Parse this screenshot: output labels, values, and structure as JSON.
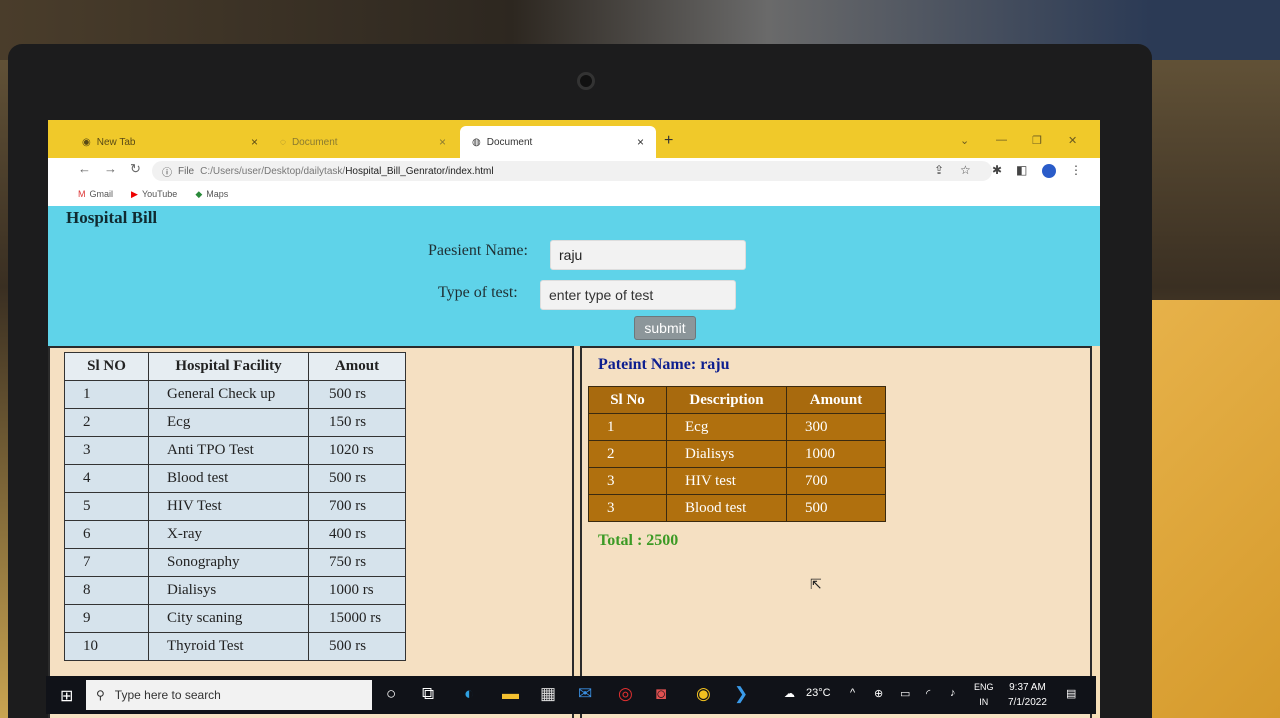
{
  "browser": {
    "tabs": [
      {
        "title": "New Tab"
      },
      {
        "title": "Document"
      },
      {
        "title": "Document"
      }
    ],
    "address": {
      "scheme": "File",
      "path_prefix": "C:/Users/user/Desktop/dailytask/",
      "path_main": "Hospital_Bill_Genrator/index.html"
    },
    "bookmarks": [
      {
        "label": "Gmail",
        "icon": "gmail-icon"
      },
      {
        "label": "YouTube",
        "icon": "youtube-icon"
      },
      {
        "label": "Maps",
        "icon": "maps-icon"
      }
    ]
  },
  "page": {
    "title": "Hospital Bill",
    "form": {
      "name_label": "Paesient Name:",
      "name_value": "raju",
      "test_label": "Type of test:",
      "test_placeholder": "enter type of test",
      "submit_label": "submit"
    },
    "facility_table": {
      "headers": [
        "Sl NO",
        "Hospital Facility",
        "Amout"
      ],
      "rows": [
        [
          "1",
          "General Check up",
          "500 rs"
        ],
        [
          "2",
          "Ecg",
          "150 rs"
        ],
        [
          "3",
          "Anti TPO Test",
          "1020 rs"
        ],
        [
          "4",
          "Blood test",
          "500 rs"
        ],
        [
          "5",
          "HIV Test",
          "700 rs"
        ],
        [
          "6",
          "X-ray",
          "400 rs"
        ],
        [
          "7",
          "Sonography",
          "750 rs"
        ],
        [
          "8",
          "Dialisys",
          "1000 rs"
        ],
        [
          "9",
          "City scaning",
          "15000 rs"
        ],
        [
          "10",
          "Thyroid Test",
          "500 rs"
        ]
      ]
    },
    "bill": {
      "patient_line": "Pateint Name: raju",
      "headers": [
        "Sl No",
        "Description",
        "Amount"
      ],
      "rows": [
        [
          "1",
          "Ecg",
          "300"
        ],
        [
          "2",
          "Dialisys",
          "1000"
        ],
        [
          "3",
          "HIV test",
          "700"
        ],
        [
          "3",
          "Blood test",
          "500"
        ]
      ],
      "total": "Total : 2500"
    }
  },
  "taskbar": {
    "search_placeholder": "Type here to search",
    "weather": "23°C",
    "lang_top": "ENG",
    "lang_bottom": "IN",
    "time": "9:37 AM",
    "date": "7/1/2022"
  },
  "colors": {
    "header_bg": "#5fd3e9",
    "page_bg": "#f5deb8",
    "bill_table_bg": "#b0700e",
    "tabbar_bg": "#f0c92a"
  }
}
